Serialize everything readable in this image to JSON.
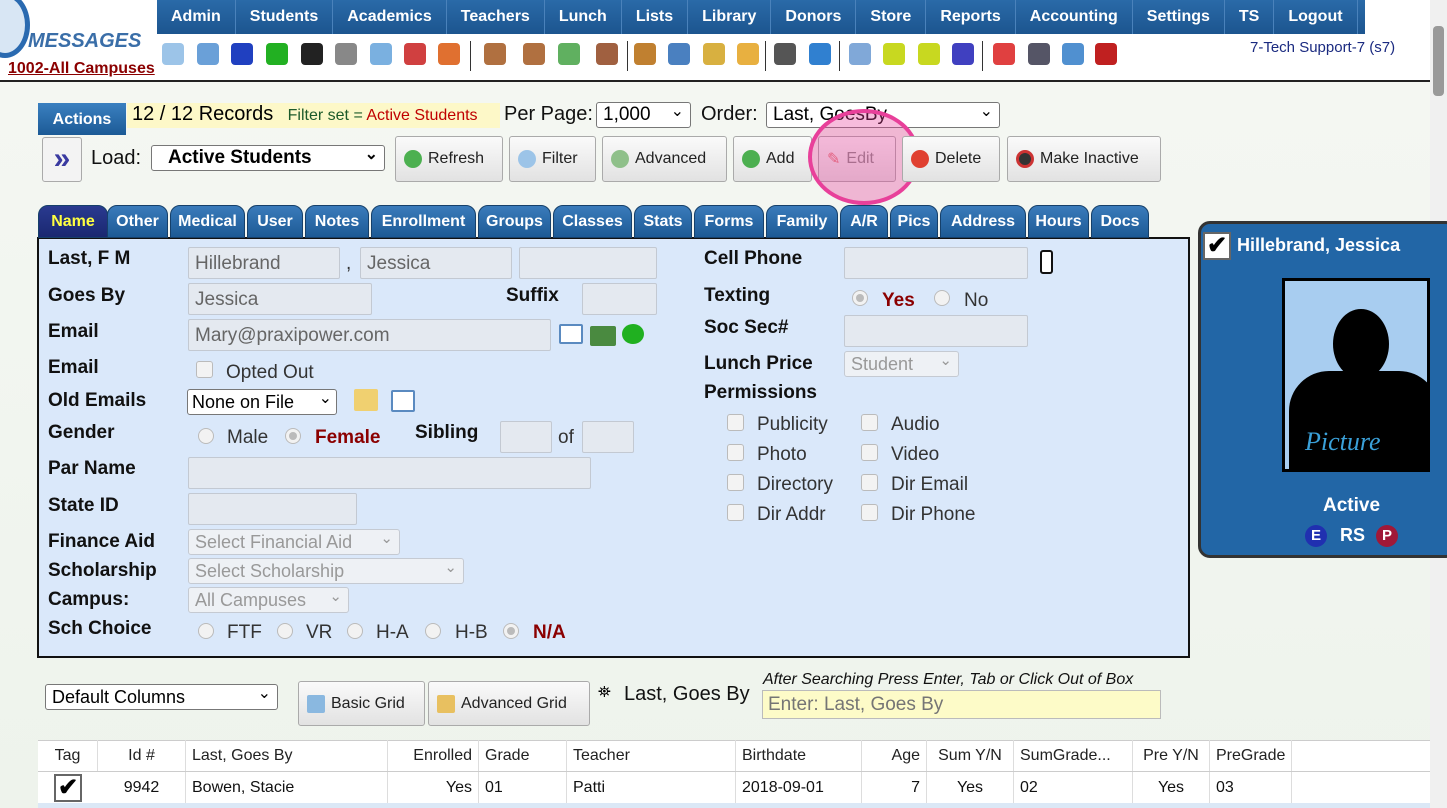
{
  "logo": {
    "text": "MESSAGES",
    "campus": "1002-All Campuses"
  },
  "nav": [
    "Admin",
    "Students",
    "Academics",
    "Teachers",
    "Lunch",
    "Lists",
    "Library",
    "Donors",
    "Store",
    "Reports",
    "Accounting",
    "Settings",
    "TS",
    "Logout"
  ],
  "user": "7-Tech Support-7 (s7)",
  "toolbar_icons": [
    "search-icon",
    "calendar-grid-icon",
    "email-at-icon",
    "text-message-icon",
    "mobile-phone-icon",
    "speaker-icon",
    "spreadsheet-icon",
    "calendar-icon",
    "megaphone-icon",
    "add-person-icon",
    "person-icon",
    "money-icon",
    "family-icon",
    "burger-icon",
    "book-icon",
    "bell-icon",
    "export-icon",
    "staff-icon",
    "alarm-clock-icon",
    "table-icon",
    "card-icon",
    "printer-icon",
    "ap-icon",
    "pdf-icon",
    "cash-register-icon",
    "help-icon",
    "alert-icon"
  ],
  "actions": {
    "label": "Actions",
    "records": "12 / 12 Records",
    "filter_prefix": "Filter set = ",
    "filter_value": "Active Students",
    "per_page_label": "Per Page:",
    "per_page": "1,000",
    "order_label": "Order:",
    "order": "Last, GoesBy",
    "load_label": "Load:",
    "load": "Active Students",
    "buttons": {
      "refresh": "Refresh",
      "filter": "Filter",
      "advanced": "Advanced",
      "add": "Add",
      "edit": "Edit",
      "delete": "Delete",
      "inactive": "Make Inactive"
    }
  },
  "tabs": [
    "Name",
    "Other",
    "Medical",
    "User",
    "Notes",
    "Enrollment",
    "Groups",
    "Classes",
    "Stats",
    "Forms",
    "Family",
    "A/R",
    "Pics",
    "Address",
    "Hours",
    "Docs"
  ],
  "form": {
    "last_label": "Last, F M",
    "last": "Hillebrand",
    "first": "Jessica",
    "comma": ",",
    "goesby_label": "Goes By",
    "goesby": "Jessica",
    "suffix_label": "Suffix",
    "email_label": "Email",
    "email": "Mary@praxipower.com",
    "email2_label": "Email",
    "opted_out": "Opted Out",
    "old_emails_label": "Old Emails",
    "old_emails": "None on File",
    "gender_label": "Gender",
    "male": "Male",
    "female": "Female",
    "sibling_label": "Sibling",
    "of": "of",
    "parname_label": "Par Name",
    "stateid_label": "State ID",
    "finaid_label": "Finance Aid",
    "finaid": "Select Financial Aid",
    "scholarship_label": "Scholarship",
    "scholarship": "Select Scholarship",
    "campus_label": "Campus:",
    "campus": "All Campuses",
    "schchoice_label": "Sch Choice",
    "sch_options": [
      "FTF",
      "VR",
      "H-A",
      "H-B",
      "N/A"
    ],
    "cell_label": "Cell Phone",
    "texting_label": "Texting",
    "yes": "Yes",
    "no": "No",
    "ssn_label": "Soc Sec#",
    "lunch_label": "Lunch Price",
    "lunch": "Student",
    "permissions_label": "Permissions",
    "permissions": [
      "Publicity",
      "Audio",
      "Photo",
      "Video",
      "Directory",
      "Dir Email",
      "Dir Addr",
      "Dir Phone"
    ]
  },
  "card": {
    "name": "Hillebrand, Jessica",
    "picture": "Picture",
    "status": "Active",
    "badges": [
      "E",
      "RS",
      "P"
    ]
  },
  "grid": {
    "columns": "Default Columns",
    "basic": "Basic Grid",
    "advanced": "Advanced Grid",
    "search_label": "Last, Goes By",
    "hint": "After Searching Press Enter, Tab or Click Out of Box",
    "search_placeholder": "Enter: Last, Goes By",
    "headers": [
      "Tag",
      "Id #",
      "Last, Goes By",
      "Enrolled",
      "Grade",
      "Teacher",
      "Birthdate",
      "Age",
      "Sum Y/N",
      "SumGrade...",
      "Pre Y/N",
      "PreGrade ..."
    ],
    "rows": [
      [
        "",
        "9942",
        "Bowen, Stacie",
        "Yes",
        "01",
        "Patti",
        "2018-09-01",
        "7",
        "Yes",
        "02",
        "Yes",
        "03"
      ]
    ]
  },
  "colors": {
    "nav": "#1f5c99",
    "panel": "#dae8fa",
    "accent_red": "#8b0000",
    "highlight": "#e8409a"
  }
}
